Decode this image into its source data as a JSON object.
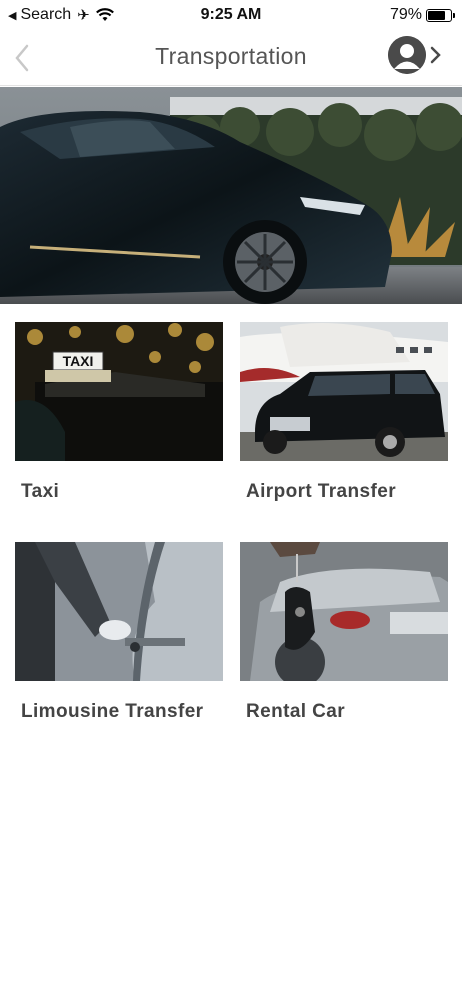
{
  "status_bar": {
    "back_app": "Search",
    "time": "9:25 AM",
    "battery_percent": "79%",
    "battery_level": 0.79
  },
  "nav": {
    "title": "Transportation",
    "back_icon": "chevron-left-icon",
    "profile_icon": "user-avatar-icon"
  },
  "hero": {
    "image": "black-luxury-suv-photo"
  },
  "services": [
    {
      "label": "Taxi",
      "image": "taxi-sign-photo"
    },
    {
      "label": "Airport Transfer",
      "image": "jet-and-limousine-photo"
    },
    {
      "label": "Limousine Transfer",
      "image": "chauffeur-opening-door-photo"
    },
    {
      "label": "Rental Car",
      "image": "car-key-photo"
    }
  ]
}
